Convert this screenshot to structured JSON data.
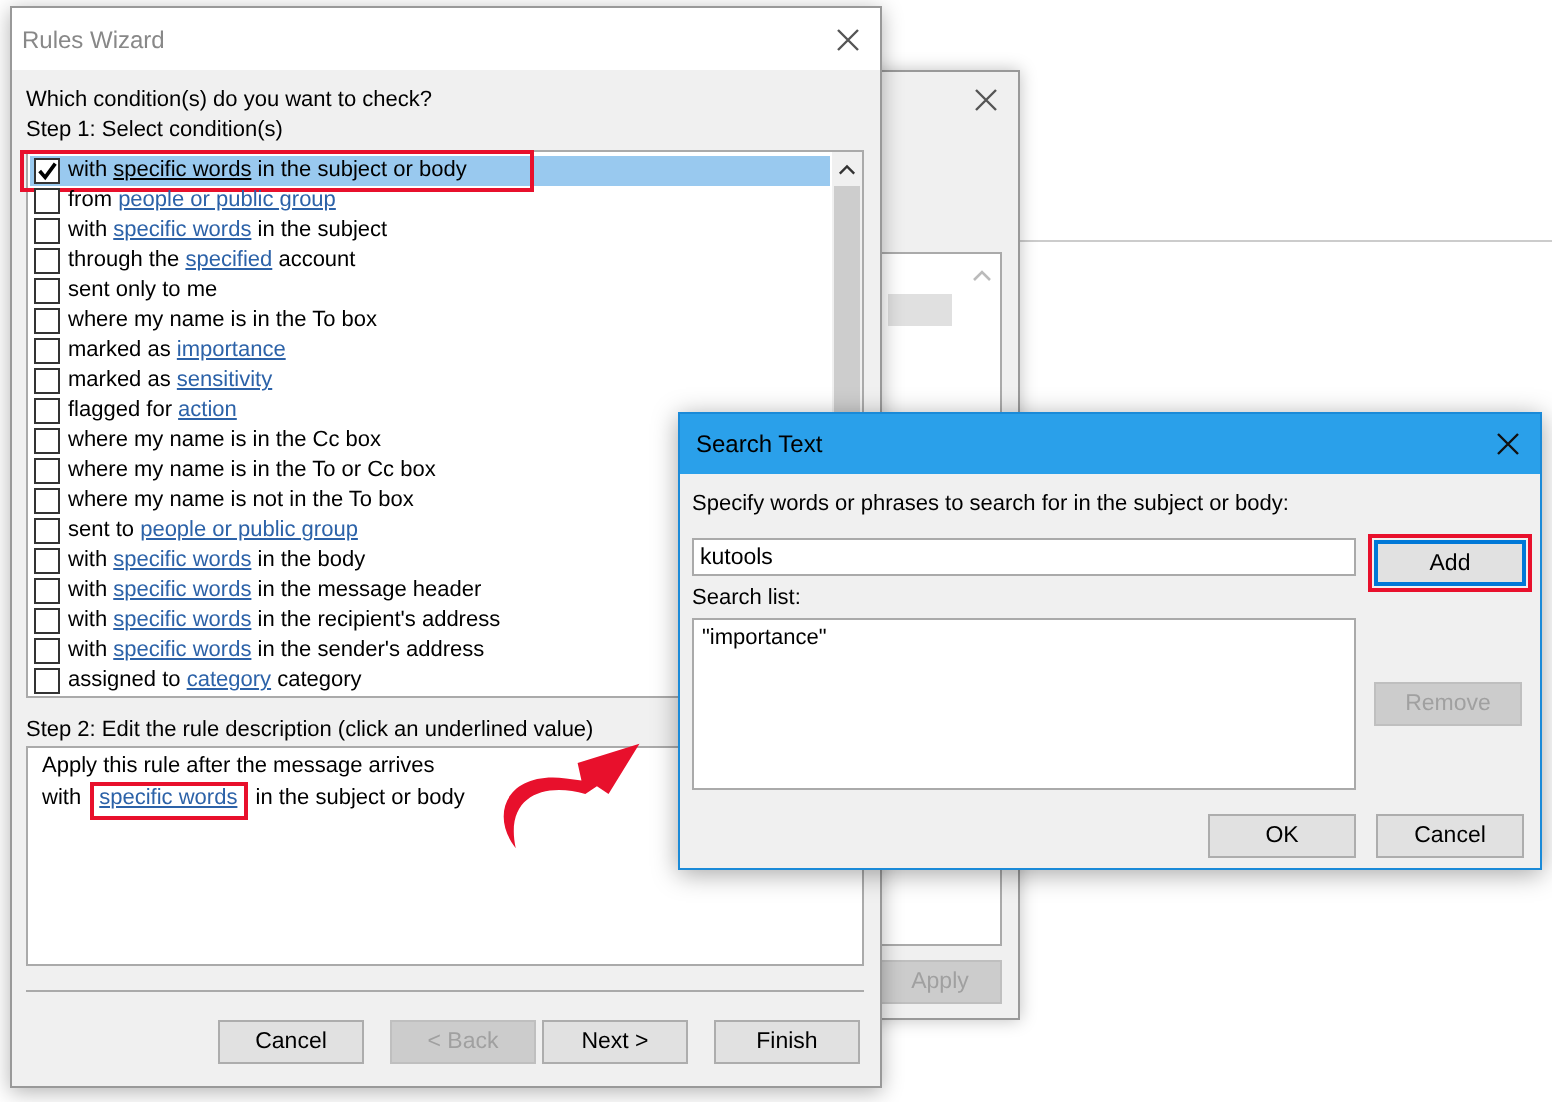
{
  "background_window": {
    "buttons": [
      {
        "label": "Apply",
        "disabled": true
      }
    ]
  },
  "rules_wizard": {
    "title": "Rules Wizard",
    "question": "Which condition(s) do you want to check?",
    "step1_label": "Step 1: Select condition(s)",
    "conditions": [
      {
        "before": "with ",
        "link": "specific words",
        "after": " in the subject or body",
        "checked": true,
        "selected": true,
        "highlighted": true
      },
      {
        "before": "from ",
        "link": "people or public group",
        "checked": false,
        "selected": false,
        "highlighted": false
      },
      {
        "before": "with ",
        "link": "specific words",
        "after": " in the subject",
        "checked": false,
        "selected": false,
        "highlighted": false
      },
      {
        "before": "through the ",
        "link": "specified",
        "after": " account",
        "checked": false,
        "selected": false,
        "highlighted": false
      },
      {
        "before": "sent only to me",
        "checked": false,
        "selected": false,
        "highlighted": false
      },
      {
        "before": "where my name is in the To box",
        "checked": false,
        "selected": false,
        "highlighted": false
      },
      {
        "before": "marked as ",
        "link": "importance",
        "checked": false,
        "selected": false,
        "highlighted": false
      },
      {
        "before": "marked as ",
        "link": "sensitivity",
        "checked": false,
        "selected": false,
        "highlighted": false
      },
      {
        "before": "flagged for ",
        "link": "action",
        "checked": false,
        "selected": false,
        "highlighted": false
      },
      {
        "before": "where my name is in the Cc box",
        "checked": false,
        "selected": false,
        "highlighted": false
      },
      {
        "before": "where my name is in the To or Cc box",
        "checked": false,
        "selected": false,
        "highlighted": false
      },
      {
        "before": "where my name is not in the To box",
        "checked": false,
        "selected": false,
        "highlighted": false
      },
      {
        "before": "sent to ",
        "link": "people or public group",
        "checked": false,
        "selected": false,
        "highlighted": false
      },
      {
        "before": "with ",
        "link": "specific words",
        "after": " in the body",
        "checked": false,
        "selected": false,
        "highlighted": false
      },
      {
        "before": "with ",
        "link": "specific words",
        "after": " in the message header",
        "checked": false,
        "selected": false,
        "highlighted": false
      },
      {
        "before": "with ",
        "link": "specific words",
        "after": " in the recipient's address",
        "checked": false,
        "selected": false,
        "highlighted": false
      },
      {
        "before": "with ",
        "link": "specific words",
        "after": " in the sender's address",
        "checked": false,
        "selected": false,
        "highlighted": false
      },
      {
        "before": "assigned to ",
        "link": "category",
        "after": " category",
        "checked": false,
        "selected": false,
        "highlighted": false
      }
    ],
    "step2_label": "Step 2: Edit the rule description (click an underlined value)",
    "description": [
      {
        "before": "Apply this rule after the message arrives"
      },
      {
        "before": "with ",
        "link": "specific words",
        "after": " in the subject or body",
        "highlighted": true
      }
    ],
    "buttons": [
      {
        "label": "Cancel",
        "disabled": false
      },
      {
        "label": "< Back",
        "disabled": true
      },
      {
        "label": "Next >",
        "disabled": false
      },
      {
        "label": "Finish",
        "disabled": false
      }
    ]
  },
  "search_text": {
    "title": "Search Text",
    "prompt": "Specify words or phrases to search for in the subject or body:",
    "value": "kutools",
    "add_button": {
      "label": "Add",
      "highlighted": true
    },
    "list_label": "Search list:",
    "list_items": [
      "\"importance\""
    ],
    "remove_button": {
      "label": "Remove",
      "disabled": true
    },
    "buttons": [
      {
        "label": "OK",
        "disabled": false
      },
      {
        "label": "Cancel",
        "disabled": false
      }
    ]
  }
}
